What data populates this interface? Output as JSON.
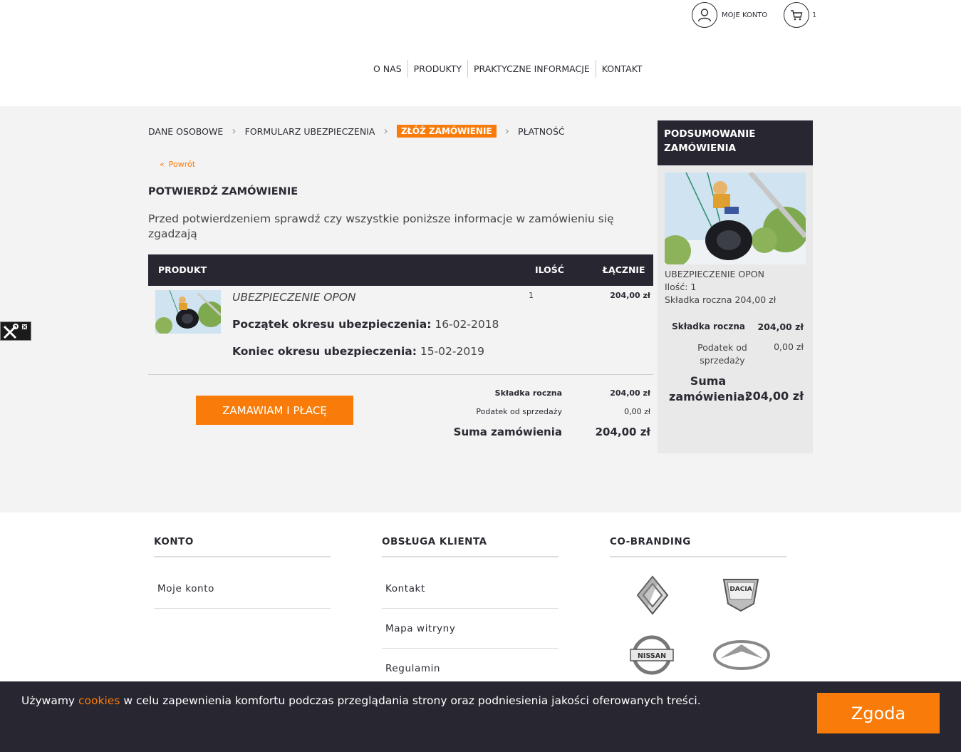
{
  "header": {
    "account_label": "MOJE KONTO",
    "cart_count": "1",
    "nav": [
      "O NAS",
      "PRODUKTY",
      "PRAKTYCZNE INFORMACJE",
      "KONTAKT"
    ]
  },
  "steps": {
    "s1": "DANE OSOBOWE",
    "s2": "FORMULARZ UBEZPIECZENIA",
    "s3": "ZŁÓŻ ZAMÓWIENIE",
    "s4": "PŁATNOŚĆ"
  },
  "back_label": "Powrót",
  "title": "POTWIERDŹ ZAMÓWIENIE",
  "intro": "Przed potwierdzeniem sprawdź czy wszystkie poniższe informacje w zamówieniu się zgadzają",
  "table": {
    "col_product": "PRODUKT",
    "col_qty": "ILOŚĆ",
    "col_total": "ŁĄCZNIE"
  },
  "item": {
    "name": "UBEZPIECZENIE OPON",
    "start_label": "Początek okresu ubezpieczenia:",
    "start_value": "16-02-2018",
    "end_label": "Koniec okresu ubezpieczenia:",
    "end_value": "15-02-2019",
    "qty": "1",
    "price": "204,00 zł"
  },
  "order_button": "ZAMAWIAM I PŁACĘ",
  "totals": {
    "premium_label": "Składka roczna",
    "premium_value": "204,00 zł",
    "tax_label": "Podatek od sprzedaży",
    "tax_value": "0,00 zł",
    "sum_label": "Suma zamówienia",
    "sum_value": "204,00 zł"
  },
  "sidebar": {
    "title": "PODSUMOWANIE ZAMÓWIENIA",
    "item_name": "UBEZPIECZENIE OPON",
    "qty_line": "Ilość: 1",
    "premium_line": "Składka roczna 204,00 zł",
    "premium_label": "Składka roczna",
    "premium_value": "204,00 zł",
    "tax_label": "Podatek od sprzedaży",
    "tax_value": "0,00 zł",
    "sum_label": "Suma zamówienia:",
    "sum_value": "204,00 zł"
  },
  "footer": {
    "col1": {
      "title": "KONTO",
      "links": [
        "Moje konto"
      ]
    },
    "col2": {
      "title": "OBSŁUGA KLIENTA",
      "links": [
        "Kontakt",
        "Mapa witryny",
        "Regulamin"
      ]
    },
    "col3": {
      "title": "CO-BRANDING",
      "brands": [
        "renault-logo",
        "dacia-logo",
        "nissan-logo",
        "infiniti-logo"
      ],
      "dacia_text": "DACIA",
      "nissan_text": "NISSAN"
    }
  },
  "cookie": {
    "before": "Używamy ",
    "link": "cookies",
    "after": " w celu zapewnienia komfortu podczas przeglądania strony oraz podniesienia jakości oferowanych treści.",
    "button": "Zgoda"
  },
  "colors": {
    "accent": "#f97c0a",
    "dark": "#282630",
    "panel": "#f3f3f3"
  }
}
